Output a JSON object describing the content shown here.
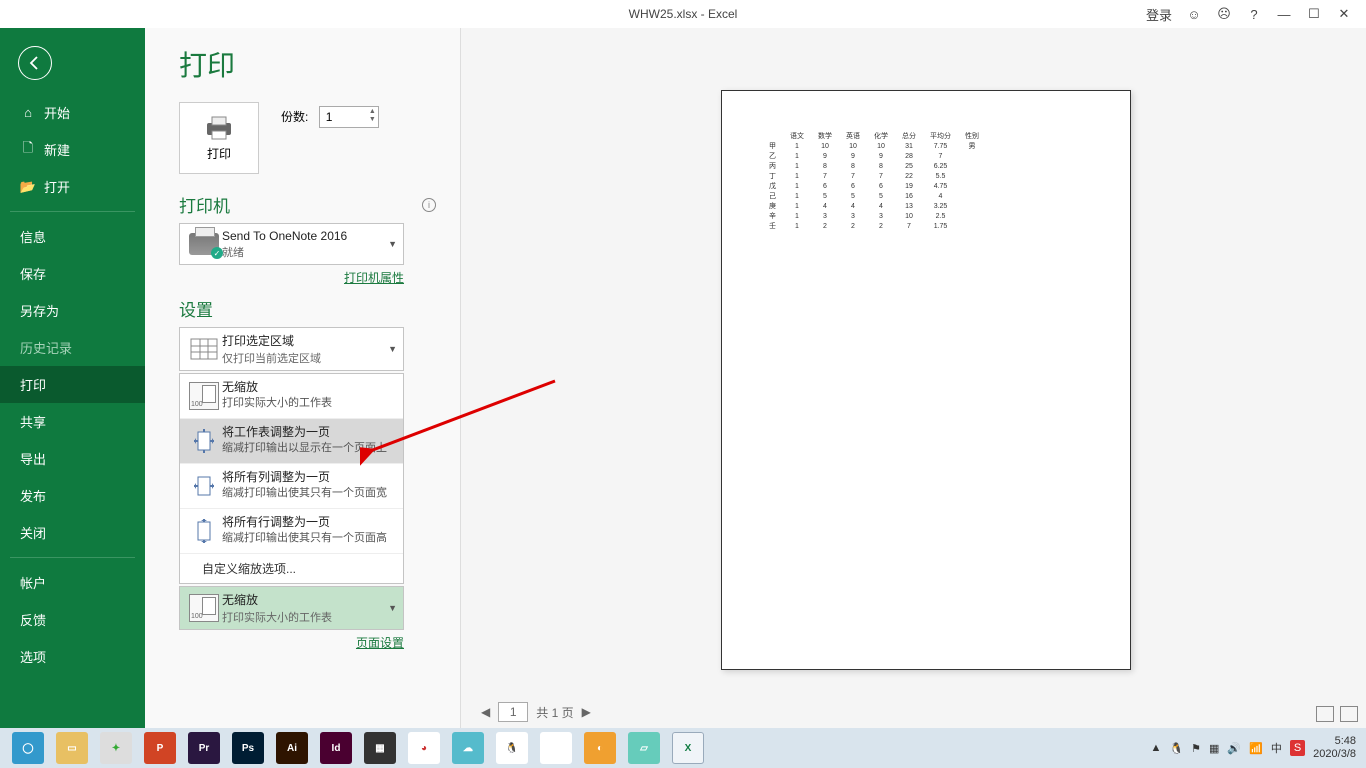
{
  "titlebar": {
    "title": "WHW25.xlsx - Excel",
    "login": "登录",
    "help": "?",
    "smile": "☺",
    "frown": "☹"
  },
  "sidebar": {
    "back_icon": "←",
    "home": "开始",
    "new": "新建",
    "open": "打开",
    "info": "信息",
    "save": "保存",
    "saveas": "另存为",
    "history": "历史记录",
    "print": "打印",
    "share": "共享",
    "export": "导出",
    "publish": "发布",
    "close": "关闭",
    "account": "帐户",
    "feedback": "反馈",
    "options": "选项"
  },
  "panel": {
    "title": "打印",
    "print_btn": "打印",
    "copies_label": "份数:",
    "copies_value": "1",
    "printer_title": "打印机",
    "printer_name": "Send To OneNote 2016",
    "printer_status": "就绪",
    "printer_props": "打印机属性",
    "settings_title": "设置",
    "area_title": "打印选定区域",
    "area_sub": "仅打印当前选定区域",
    "scale_options": [
      {
        "title": "无缩放",
        "sub": "打印实际大小的工作表",
        "icon": "100"
      },
      {
        "title": "将工作表调整为一页",
        "sub": "缩减打印输出以显示在一个页面上",
        "icon": "fit-both"
      },
      {
        "title": "将所有列调整为一页",
        "sub": "缩减打印输出使其只有一个页面宽",
        "icon": "fit-cols"
      },
      {
        "title": "将所有行调整为一页",
        "sub": "缩减打印输出使其只有一个页面高",
        "icon": "fit-rows"
      }
    ],
    "custom_scale": "自定义缩放选项...",
    "selected_title": "无缩放",
    "selected_sub": "打印实际大小的工作表",
    "page_setup": "页面设置"
  },
  "preview": {
    "nav_prev": "◀",
    "nav_next": "▶",
    "page": "1",
    "total": "共 1 页"
  },
  "chart_data": {
    "type": "table",
    "headers": [
      "",
      "语文",
      "数学",
      "英语",
      "化学",
      "总分",
      "平均分",
      "性别"
    ],
    "rows": [
      [
        "甲",
        "1",
        "10",
        "10",
        "10",
        "31",
        "7.75",
        "男"
      ],
      [
        "乙",
        "1",
        "9",
        "9",
        "9",
        "28",
        "7",
        ""
      ],
      [
        "丙",
        "1",
        "8",
        "8",
        "8",
        "25",
        "6.25",
        ""
      ],
      [
        "丁",
        "1",
        "7",
        "7",
        "7",
        "22",
        "5.5",
        ""
      ],
      [
        "戊",
        "1",
        "6",
        "6",
        "6",
        "19",
        "4.75",
        ""
      ],
      [
        "己",
        "1",
        "5",
        "5",
        "5",
        "16",
        "4",
        ""
      ],
      [
        "庚",
        "1",
        "4",
        "4",
        "4",
        "13",
        "3.25",
        ""
      ],
      [
        "辛",
        "1",
        "3",
        "3",
        "3",
        "10",
        "2.5",
        ""
      ],
      [
        "壬",
        "1",
        "2",
        "2",
        "2",
        "7",
        "1.75",
        ""
      ]
    ]
  },
  "taskbar": {
    "time": "5:48",
    "date": "2020/3/8"
  }
}
